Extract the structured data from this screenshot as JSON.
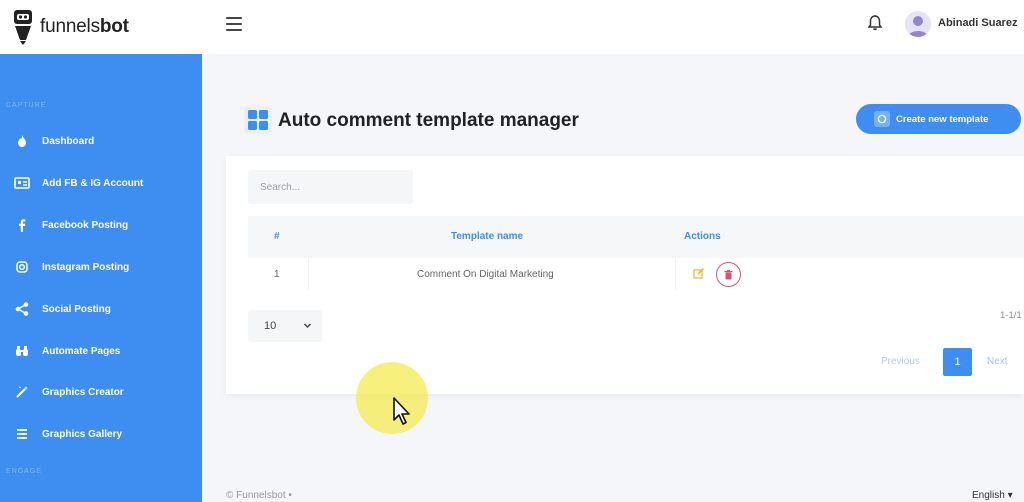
{
  "brand": {
    "name_prefix": "funnels",
    "name_bold": "bot"
  },
  "user": {
    "name": "Abinadi Suarez"
  },
  "sidebar": {
    "section_top": "CAPTURE",
    "section_bottom": "ENGAGE",
    "items": [
      {
        "label": "Dashboard",
        "icon": "fire-icon"
      },
      {
        "label": "Add FB & IG Account",
        "icon": "id-card-icon"
      },
      {
        "label": "Facebook Posting",
        "icon": "facebook-icon"
      },
      {
        "label": "Instagram Posting",
        "icon": "instagram-icon"
      },
      {
        "label": "Social Posting",
        "icon": "share-icon"
      },
      {
        "label": "Automate Pages",
        "icon": "binoculars-icon"
      },
      {
        "label": "Graphics Creator",
        "icon": "magic-wand-icon"
      },
      {
        "label": "Graphics Gallery",
        "icon": "list-icon"
      }
    ]
  },
  "page": {
    "title": "Auto comment template manager",
    "create_button": "Create new template"
  },
  "table": {
    "search_placeholder": "Search...",
    "columns": [
      "#",
      "Template name",
      "Actions"
    ],
    "rows": [
      {
        "index": "1",
        "name": "Comment On Digital Marketing"
      }
    ],
    "page_size": "10",
    "range": "1-1/1",
    "prev_label": "Previous",
    "current_page": "1",
    "next_label": "Next"
  },
  "footer": {
    "copyright": "© Funnelsbot",
    "dot": "•",
    "language": "English"
  },
  "colors": {
    "accent": "#3d8ef0",
    "sidebar": "#3d8ef0",
    "danger": "#d9536f",
    "edit": "#f0b429"
  }
}
